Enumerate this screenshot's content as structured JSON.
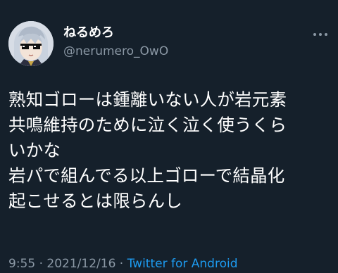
{
  "tweet": {
    "display_name": "ねるめろ",
    "handle": "@nerumero_OwO",
    "lines": [
      "熟知ゴローは鍾離いない人が岩元素",
      "共鳴維持のために泣く泣く使うくら",
      "いかな",
      "岩パで組んでる以上ゴローで結晶化",
      "起こせるとは限らんし"
    ],
    "time": "9:55",
    "separator": "·",
    "date": "2021/12/16",
    "source": "Twitter for Android"
  },
  "icons": {
    "avatar": "avatar-anime-girl-with-pixel-sunglasses",
    "more": "more-options-horizontal-dots-icon"
  },
  "colors": {
    "background": "#15202b",
    "text_primary": "#ffffff",
    "text_secondary": "#8b98a5",
    "link": "#1d9bf0"
  }
}
